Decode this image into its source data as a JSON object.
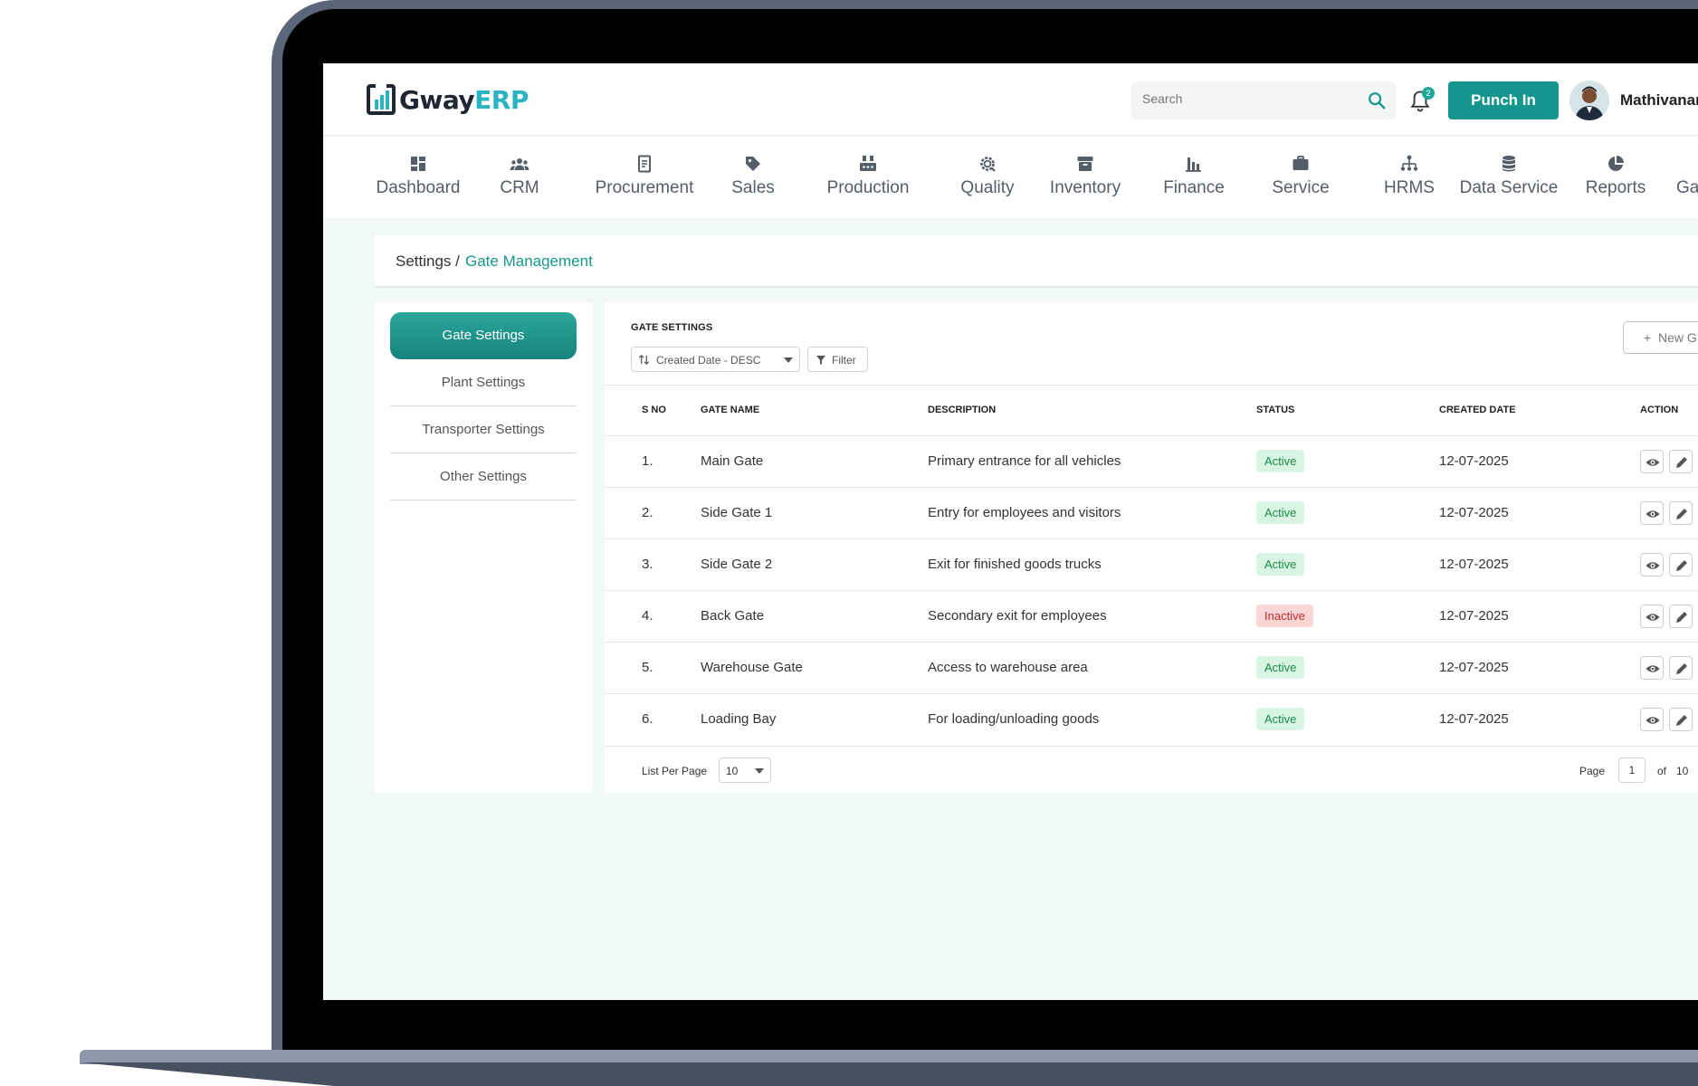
{
  "header": {
    "logo_part1": "Gway",
    "logo_part2": "ERP",
    "search_placeholder": "Search",
    "notification_count": "2",
    "punch_label": "Punch In",
    "user_name": "Mathivanan"
  },
  "nav": {
    "items": [
      {
        "label": "Dashboard",
        "icon": "dashboard-icon"
      },
      {
        "label": "CRM",
        "icon": "users-icon"
      },
      {
        "label": "Procurement",
        "icon": "document-icon"
      },
      {
        "label": "Sales",
        "icon": "tag-icon"
      },
      {
        "label": "Production",
        "icon": "factory-icon"
      },
      {
        "label": "Quality",
        "icon": "quality-gear-icon"
      },
      {
        "label": "Inventory",
        "icon": "archive-box-icon"
      },
      {
        "label": "Finance",
        "icon": "bar-chart-icon"
      },
      {
        "label": "Service",
        "icon": "briefcase-icon"
      },
      {
        "label": "HRMS",
        "icon": "org-chart-icon"
      },
      {
        "label": "Data Service",
        "icon": "database-icon"
      },
      {
        "label": "Reports",
        "icon": "pie-chart-icon"
      },
      {
        "label": "Ga",
        "icon": ""
      }
    ]
  },
  "breadcrumb": {
    "root": "Settings /",
    "current": "Gate Management"
  },
  "sidebar": {
    "items": [
      {
        "label": "Gate Settings",
        "active": true
      },
      {
        "label": "Plant Settings",
        "active": false
      },
      {
        "label": "Transporter Settings",
        "active": false
      },
      {
        "label": "Other Settings",
        "active": false
      }
    ]
  },
  "main": {
    "title": "GATE SETTINGS",
    "sort_value": "Created Date - DESC",
    "filter_label": "Filter",
    "new_label": "New G",
    "columns": [
      "S NO",
      "GATE NAME",
      "DESCRIPTION",
      "STATUS",
      "CREATED DATE",
      "ACTION"
    ],
    "rows": [
      {
        "sno": "1.",
        "name": "Main Gate",
        "description": "Primary entrance for all vehicles",
        "status": "Active",
        "created": "12-07-2025"
      },
      {
        "sno": "2.",
        "name": "Side Gate 1",
        "description": "Entry for employees and visitors",
        "status": "Active",
        "created": "12-07-2025"
      },
      {
        "sno": "3.",
        "name": "Side Gate 2",
        "description": "Exit for finished goods trucks",
        "status": "Active",
        "created": "12-07-2025"
      },
      {
        "sno": "4.",
        "name": "Back Gate",
        "description": "Secondary exit for employees",
        "status": "Inactive",
        "created": "12-07-2025"
      },
      {
        "sno": "5.",
        "name": "Warehouse Gate",
        "description": "Access to warehouse area",
        "status": "Active",
        "created": "12-07-2025"
      },
      {
        "sno": "6.",
        "name": "Loading Bay",
        "description": "For loading/unloading goods",
        "status": "Active",
        "created": "12-07-2025"
      }
    ],
    "footer": {
      "per_page_label": "List Per Page",
      "per_page_value": "10",
      "page_label": "Page",
      "page_value": "1",
      "of_label": "of",
      "total_pages": "10"
    }
  },
  "colors": {
    "accent": "#16968f",
    "active_bg": "#d8f5e3",
    "inactive_bg": "#fbd6d6",
    "logo_accent": "#2bb3c4"
  }
}
